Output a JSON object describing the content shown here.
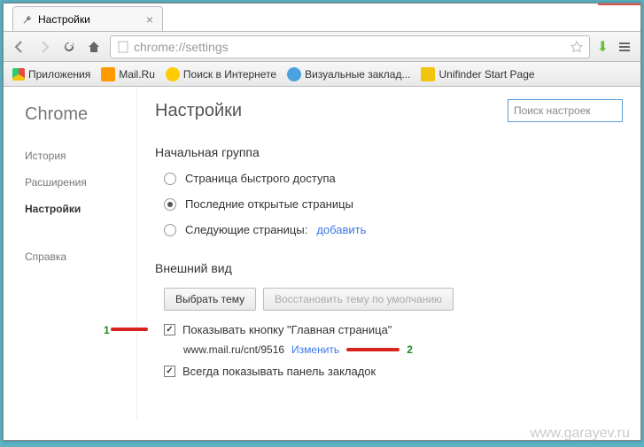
{
  "window": {
    "tab_title": "Настройки"
  },
  "omnibox": {
    "url": "chrome://settings"
  },
  "bookmarks": {
    "apps": "Приложения",
    "mailru": "Mail.Ru",
    "search": "Поиск в Интернете",
    "visual": "Визуальные заклад...",
    "unifinder": "Unifinder Start Page"
  },
  "sidebar": {
    "brand": "Chrome",
    "history": "История",
    "extensions": "Расширения",
    "settings": "Настройки",
    "help": "Справка"
  },
  "main": {
    "title": "Настройки",
    "search_placeholder": "Поиск настроек"
  },
  "startup": {
    "title": "Начальная группа",
    "opt_quick": "Страница быстрого доступа",
    "opt_last": "Последние открытые страницы",
    "opt_specific": "Следующие страницы:",
    "add_link": "добавить"
  },
  "appearance": {
    "title": "Внешний вид",
    "btn_theme": "Выбрать тему",
    "btn_reset": "Восстановить тему по умолчанию",
    "show_home": "Показывать кнопку \"Главная страница\"",
    "home_url": "www.mail.ru/cnt/9516",
    "change_link": "Изменить",
    "show_bookmarks": "Всегда показывать панель закладок"
  },
  "annotations": {
    "one": "1",
    "two": "2"
  },
  "watermark": "www.garayev.ru"
}
